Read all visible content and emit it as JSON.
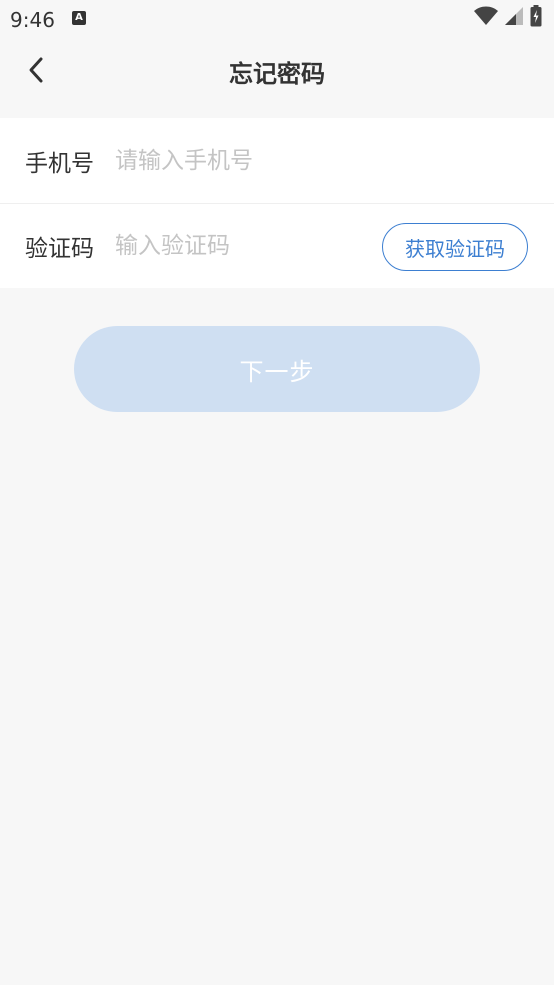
{
  "status_bar": {
    "time": "9:46",
    "notification_letter": "A"
  },
  "header": {
    "title": "忘记密码"
  },
  "form": {
    "phone": {
      "label": "手机号",
      "placeholder": "请输入手机号",
      "value": ""
    },
    "code": {
      "label": "验证码",
      "placeholder": "输入验证码",
      "value": "",
      "button_label": "获取验证码"
    }
  },
  "next_button": {
    "label": "下一步"
  },
  "colors": {
    "accent": "#3d7fd1",
    "disabled_button": "#cfdff2",
    "background": "#f7f7f7"
  },
  "icons": {
    "back": "chevron-left-icon",
    "wifi": "wifi-icon",
    "signal": "cellular-signal-icon",
    "battery": "battery-icon"
  }
}
